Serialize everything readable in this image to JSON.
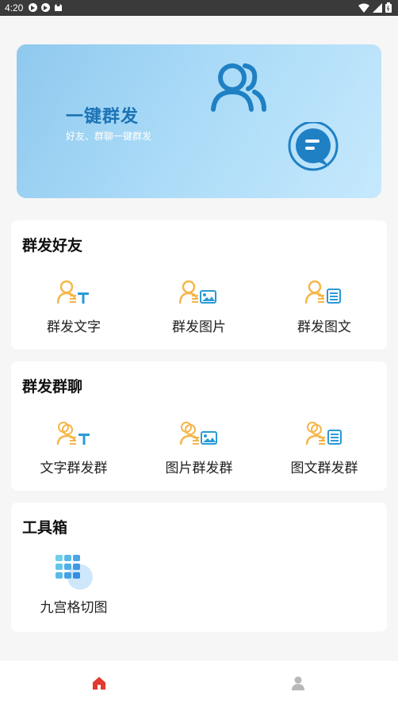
{
  "status_bar": {
    "time": "4:20",
    "left_icons": [
      "send-icon",
      "send-icon",
      "cat-icon"
    ],
    "right_icons": [
      "wifi-icon",
      "signal-icon",
      "battery-icon"
    ]
  },
  "banner": {
    "title": "一键群发",
    "subtitle": "好友、群聊一键群发"
  },
  "sections": {
    "friends": {
      "title": "群发好友",
      "items": [
        {
          "label": "群发文字",
          "icon": "user-text-icon"
        },
        {
          "label": "群发图片",
          "icon": "user-image-icon"
        },
        {
          "label": "群发图文",
          "icon": "user-article-icon"
        }
      ]
    },
    "groups": {
      "title": "群发群聊",
      "items": [
        {
          "label": "文字群发群",
          "icon": "group-text-icon"
        },
        {
          "label": "图片群发群",
          "icon": "group-image-icon"
        },
        {
          "label": "图文群发群",
          "icon": "group-article-icon"
        }
      ]
    },
    "tools": {
      "title": "工具箱",
      "items": [
        {
          "label": "九宫格切图",
          "icon": "grid-icon"
        }
      ]
    }
  },
  "tab_bar": {
    "tabs": [
      {
        "icon": "home-icon",
        "active": true
      },
      {
        "icon": "profile-icon",
        "active": false
      }
    ]
  },
  "colors": {
    "accent": "#1c73b6",
    "icon_orange": "#f5b64a",
    "icon_blue": "#2a9ad8",
    "active_tab": "#e23a2e",
    "inactive_tab": "#b8b8b8"
  }
}
